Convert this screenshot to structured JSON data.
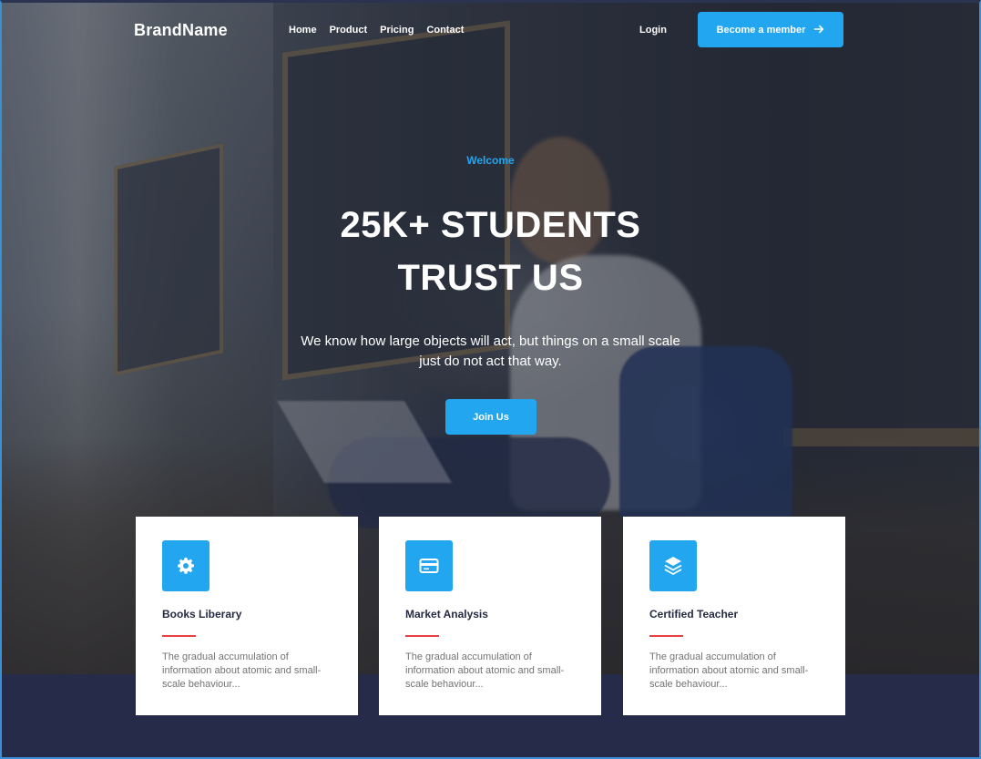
{
  "nav": {
    "brand": "BrandName",
    "links": [
      "Home",
      "Product",
      "Pricing",
      "Contact"
    ],
    "login": "Login",
    "cta": "Become a member",
    "cta_icon": "arrow-right-icon"
  },
  "hero": {
    "eyebrow": "Welcome",
    "headline_line1": "25K+ STUDENTS",
    "headline_line2": "TRUST US",
    "subtitle": "We know how large objects will act, but things on a small scale just do not act that way.",
    "button": "Join Us"
  },
  "cards": [
    {
      "icon": "gear-icon",
      "title": "Books Liberary",
      "description": "The gradual accumulation of information about atomic and small-scale behaviour..."
    },
    {
      "icon": "credit-card-icon",
      "title": "Market Analysis",
      "description": "The gradual accumulation of information about atomic and small-scale behaviour..."
    },
    {
      "icon": "layers-icon",
      "title": "Certified Teacher",
      "description": "The gradual accumulation of information about atomic and small-scale behaviour..."
    }
  ],
  "colors": {
    "primary": "#23a6f0",
    "dark": "#252b42",
    "accent_line": "#e74040",
    "text_muted": "#737373",
    "footer_bg": "#252b48"
  }
}
